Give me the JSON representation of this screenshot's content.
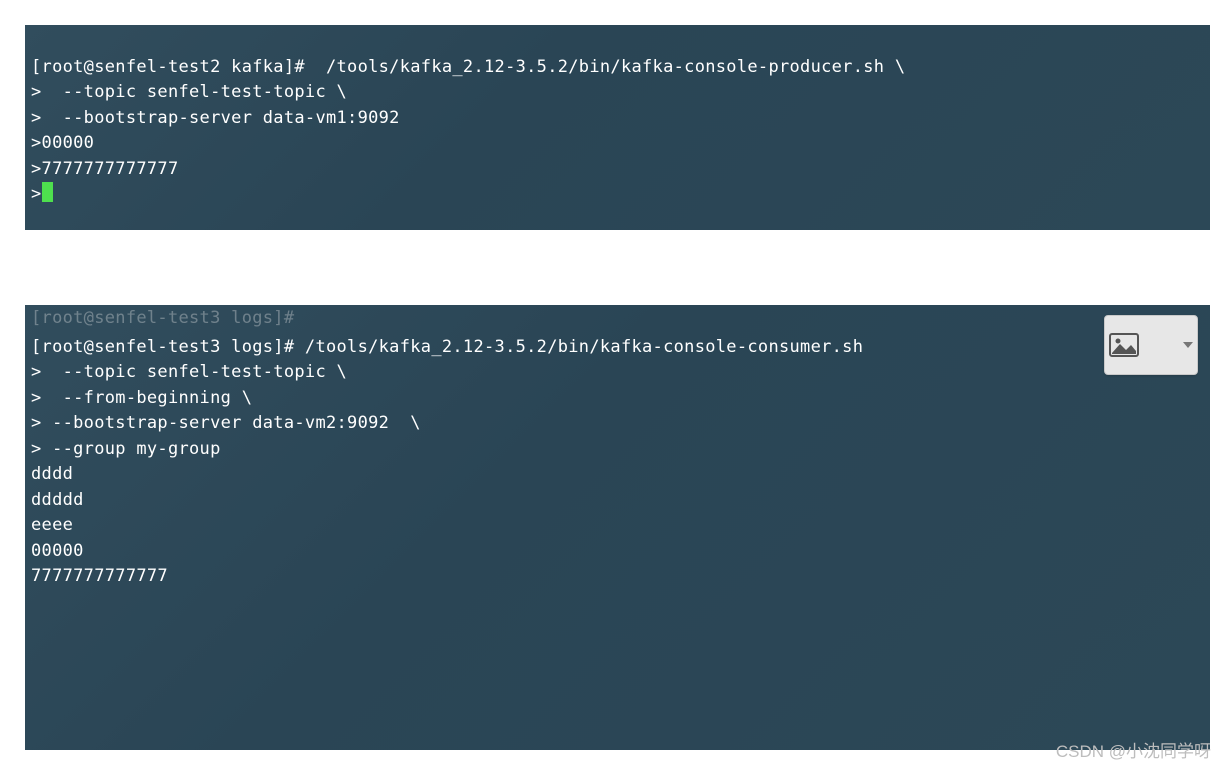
{
  "terminal1": {
    "lines": [
      "[root@senfel-test2 kafka]#  /tools/kafka_2.12-3.5.2/bin/kafka-console-producer.sh \\",
      ">  --topic senfel-test-topic \\",
      ">  --bootstrap-server data-vm1:9092",
      ">00000",
      ">7777777777777"
    ],
    "prompt_last": ">"
  },
  "terminal2": {
    "cut_line": "[root@senfel-test3 logs]#",
    "lines": [
      "[root@senfel-test3 logs]# /tools/kafka_2.12-3.5.2/bin/kafka-console-consumer.sh",
      ">  --topic senfel-test-topic \\",
      ">  --from-beginning \\",
      "> --bootstrap-server data-vm2:9092  \\",
      "> --group my-group",
      "dddd",
      "ddddd",
      "eeee",
      "00000",
      "7777777777777"
    ]
  },
  "watermark": "CSDN @小沈同学呀",
  "icons": {
    "image_button": "image-icon",
    "dropdown": "chevron-down-icon"
  }
}
